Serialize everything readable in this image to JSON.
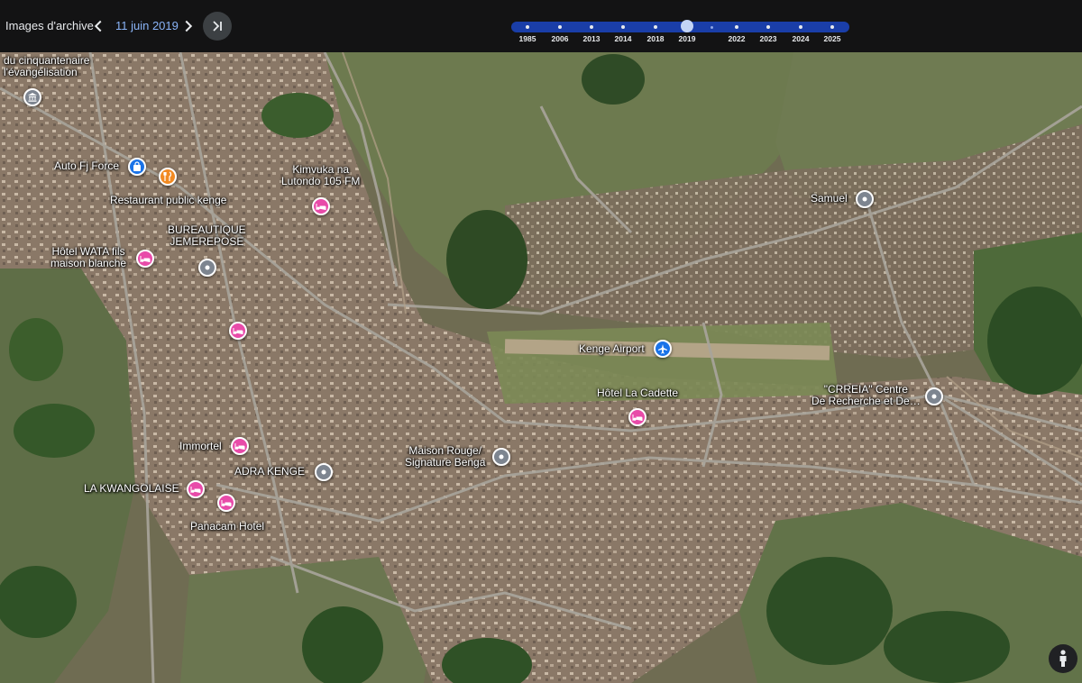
{
  "header": {
    "title": "Images d'archive",
    "date": "11 juin 2019",
    "timeline_years": [
      "1985",
      "2006",
      "2013",
      "2014",
      "2018",
      "2019",
      "2022",
      "2023",
      "2024",
      "2025"
    ],
    "selected_year": "2019"
  },
  "map": {
    "labels": {
      "cinquantenaire": "du cinquantenaire\nl'évangélisation",
      "auto_fj_force": "Auto Fj Force",
      "restaurant": "Restaurant public kenge",
      "kimvuka": "Kimvuka na\nLutondo 105 FM",
      "bureautique": "BUREAUTIQUE\nJEMEREPOSE",
      "hotel_wata": "Hôtel WATA fils\nmaison blanche",
      "samuel": "Samuel",
      "kenge_airport": "Kenge Airport",
      "hotel_cadette": "Hôtel La Cadette",
      "crreia": "\"CRREIA\" Centre\nDe Recherche et De…",
      "maison_rouge": "Maison Rouge/\nSignature Benga",
      "immortel": "Immortel",
      "adra": "ADRA KENGE",
      "kwangolaise": "LA KWANGOLAISE",
      "panacam": "Panacam Hotel"
    },
    "icons": {
      "museum": "museum-icon",
      "pin": "location-pin-icon",
      "hotel": "hotel-icon",
      "restaurant": "restaurant-icon",
      "shopping": "shopping-bag-icon",
      "airport": "airplane-icon",
      "pegman": "pegman-icon"
    },
    "colors": {
      "pin_gray": "#7d8590",
      "pin_pink": "#e84ba9",
      "pin_blue": "#1a73e8",
      "pin_orange": "#f28a22",
      "timeline": "#1a3ea8"
    }
  }
}
